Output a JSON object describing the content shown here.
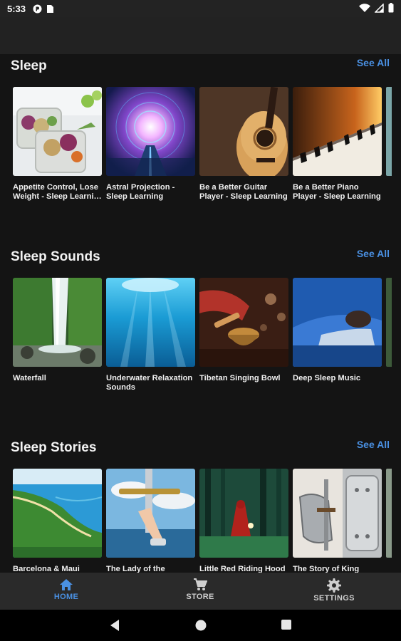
{
  "status_bar": {
    "time": "5:33",
    "left_icons": [
      "pocket-casts-icon",
      "sim-card-icon"
    ],
    "right_icons": [
      "wifi-icon",
      "signal-icon",
      "battery-icon"
    ]
  },
  "sections": [
    {
      "title": "Sleep",
      "see_all": "See All",
      "items": [
        {
          "caption": "Appetite Control, Lose Weight - Sleep Learni…",
          "image": "salad-containers"
        },
        {
          "caption": "Astral Projection - Sleep Learning",
          "image": "astral-tunnel"
        },
        {
          "caption": "Be a Better Guitar Player - Sleep Learning",
          "image": "guitar"
        },
        {
          "caption": "Be a Better Piano Player - Sleep Learning",
          "image": "piano-keys"
        }
      ]
    },
    {
      "title": "Sleep Sounds",
      "see_all": "See All",
      "items": [
        {
          "caption": "Waterfall",
          "image": "waterfall"
        },
        {
          "caption": "Underwater Relaxation Sounds",
          "image": "underwater"
        },
        {
          "caption": "Tibetan Singing Bowl",
          "image": "singing-bowl"
        },
        {
          "caption": "Deep Sleep Music",
          "image": "sleeping-man"
        }
      ]
    },
    {
      "title": "Sleep Stories",
      "see_all": "See All",
      "items": [
        {
          "caption": "Barcelona & Maui",
          "image": "island-coast"
        },
        {
          "caption": "The Lady of the",
          "image": "sword-lake"
        },
        {
          "caption": "Little Red Riding Hood",
          "image": "forest-red-cloak"
        },
        {
          "caption": "The Story of King",
          "image": "knight-armor"
        }
      ]
    }
  ],
  "bottom_nav": {
    "items": [
      {
        "label": "HOME",
        "icon": "home-icon",
        "active": true
      },
      {
        "label": "STORE",
        "icon": "cart-icon",
        "active": false
      },
      {
        "label": "SETTINGS",
        "icon": "gear-icon",
        "active": false
      }
    ]
  },
  "colors": {
    "accent": "#4a90e2",
    "background": "#141414",
    "bottom_nav_bg": "#2a2a2a",
    "inactive_nav": "#cfcfcf"
  }
}
